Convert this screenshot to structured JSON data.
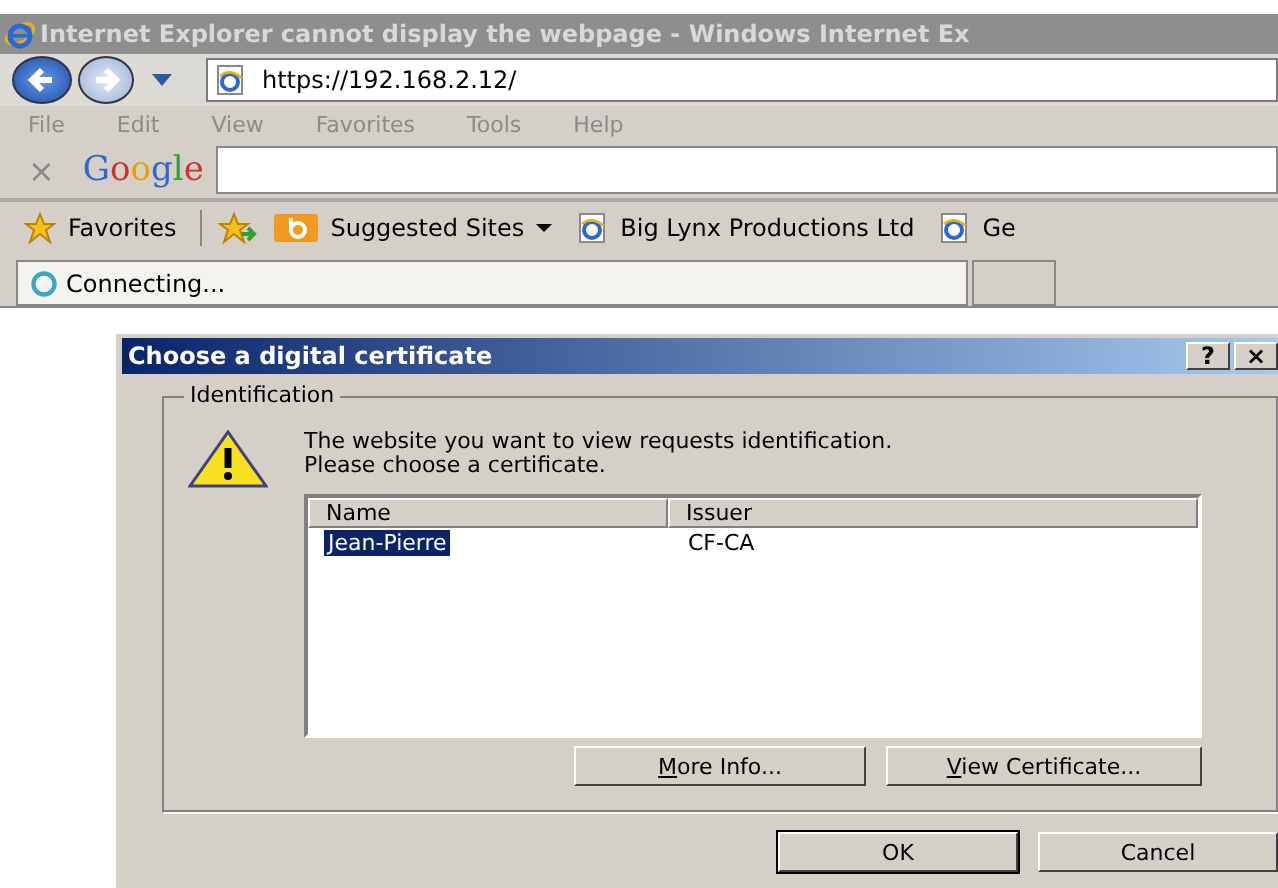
{
  "window": {
    "title": "Internet Explorer cannot display the webpage - Windows Internet Ex"
  },
  "address_bar": {
    "url": "https://192.168.2.12/"
  },
  "menu": [
    "File",
    "Edit",
    "View",
    "Favorites",
    "Tools",
    "Help"
  ],
  "google_bar": {
    "close": "×",
    "logo": "Google"
  },
  "favorites_bar": {
    "favorites": "Favorites",
    "items": [
      {
        "label": "Suggested Sites",
        "kind": "dropdown"
      },
      {
        "label": "Big Lynx Productions Ltd",
        "kind": "page"
      },
      {
        "label": "Ge",
        "kind": "page"
      }
    ]
  },
  "tab": {
    "label": "Connecting..."
  },
  "dialog": {
    "title": "Choose a digital certificate",
    "help": "?",
    "close": "×",
    "group": "Identification",
    "message": "The website you want to view requests identification.\nPlease choose a certificate.",
    "columns": [
      "Name",
      "Issuer"
    ],
    "rows": [
      {
        "name": "Jean-Pierre",
        "issuer": "CF-CA",
        "selected": true
      }
    ],
    "side_buttons": [
      "More Info...",
      "View Certificate..."
    ],
    "buttons": [
      "OK",
      "Cancel"
    ]
  }
}
